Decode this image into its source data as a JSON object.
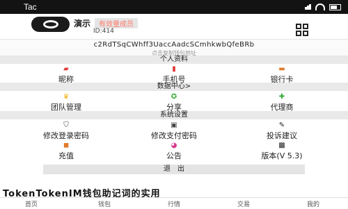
{
  "statusbar": {
    "carrier": "Tac"
  },
  "profile": {
    "name": "演示",
    "tag": "有效量成员",
    "uid": "ID:414"
  },
  "wallet": {
    "address": "c2RdTSqCWhff3UaccAadcSCmhkwbQfeBRb",
    "address_hint": "点击复制钱包地址"
  },
  "sections": {
    "personal": {
      "title": "个人资料",
      "items": [
        {
          "label": "昵称",
          "icon": "user-tag-icon",
          "color": "#e03a3a"
        },
        {
          "label": "手机号",
          "icon": "phone-icon",
          "color": "#e03a3a"
        },
        {
          "label": "银行卡",
          "icon": "bank-card-icon",
          "color": "#e07a2a"
        }
      ]
    },
    "data": {
      "title": "数据中心>",
      "items": [
        {
          "label": "团队管理",
          "icon": "crown-icon",
          "color": "#f0b419"
        },
        {
          "label": "分享",
          "icon": "share-icon",
          "color": "#33aa33"
        },
        {
          "label": "代理商",
          "icon": "agent-icon",
          "color": "#33aa33"
        }
      ]
    },
    "settings": {
      "title": "系统设置",
      "items_row1": [
        {
          "label": "修改登录密码",
          "icon": "shield-icon",
          "color": "#444444"
        },
        {
          "label": "修改支付密码",
          "icon": "lock-icon",
          "color": "#444444"
        },
        {
          "label": "投诉建议",
          "icon": "feedback-icon",
          "color": "#222222"
        }
      ],
      "items_row2": [
        {
          "label": "充值",
          "icon": "wallet-icon",
          "color": "#e07a2a"
        },
        {
          "label": "公告",
          "icon": "megaphone-icon",
          "color": "#d63a8a"
        },
        {
          "label": "版本(V 5.3)",
          "icon": "version-icon",
          "color": "#222222"
        }
      ]
    }
  },
  "logout": {
    "label": "退　出"
  },
  "overlay_title": "TokenTokenIM钱包助记词的实用",
  "tabbar": {
    "tabs": [
      "首页",
      "钱包",
      "行情",
      "交易",
      "我的"
    ]
  }
}
